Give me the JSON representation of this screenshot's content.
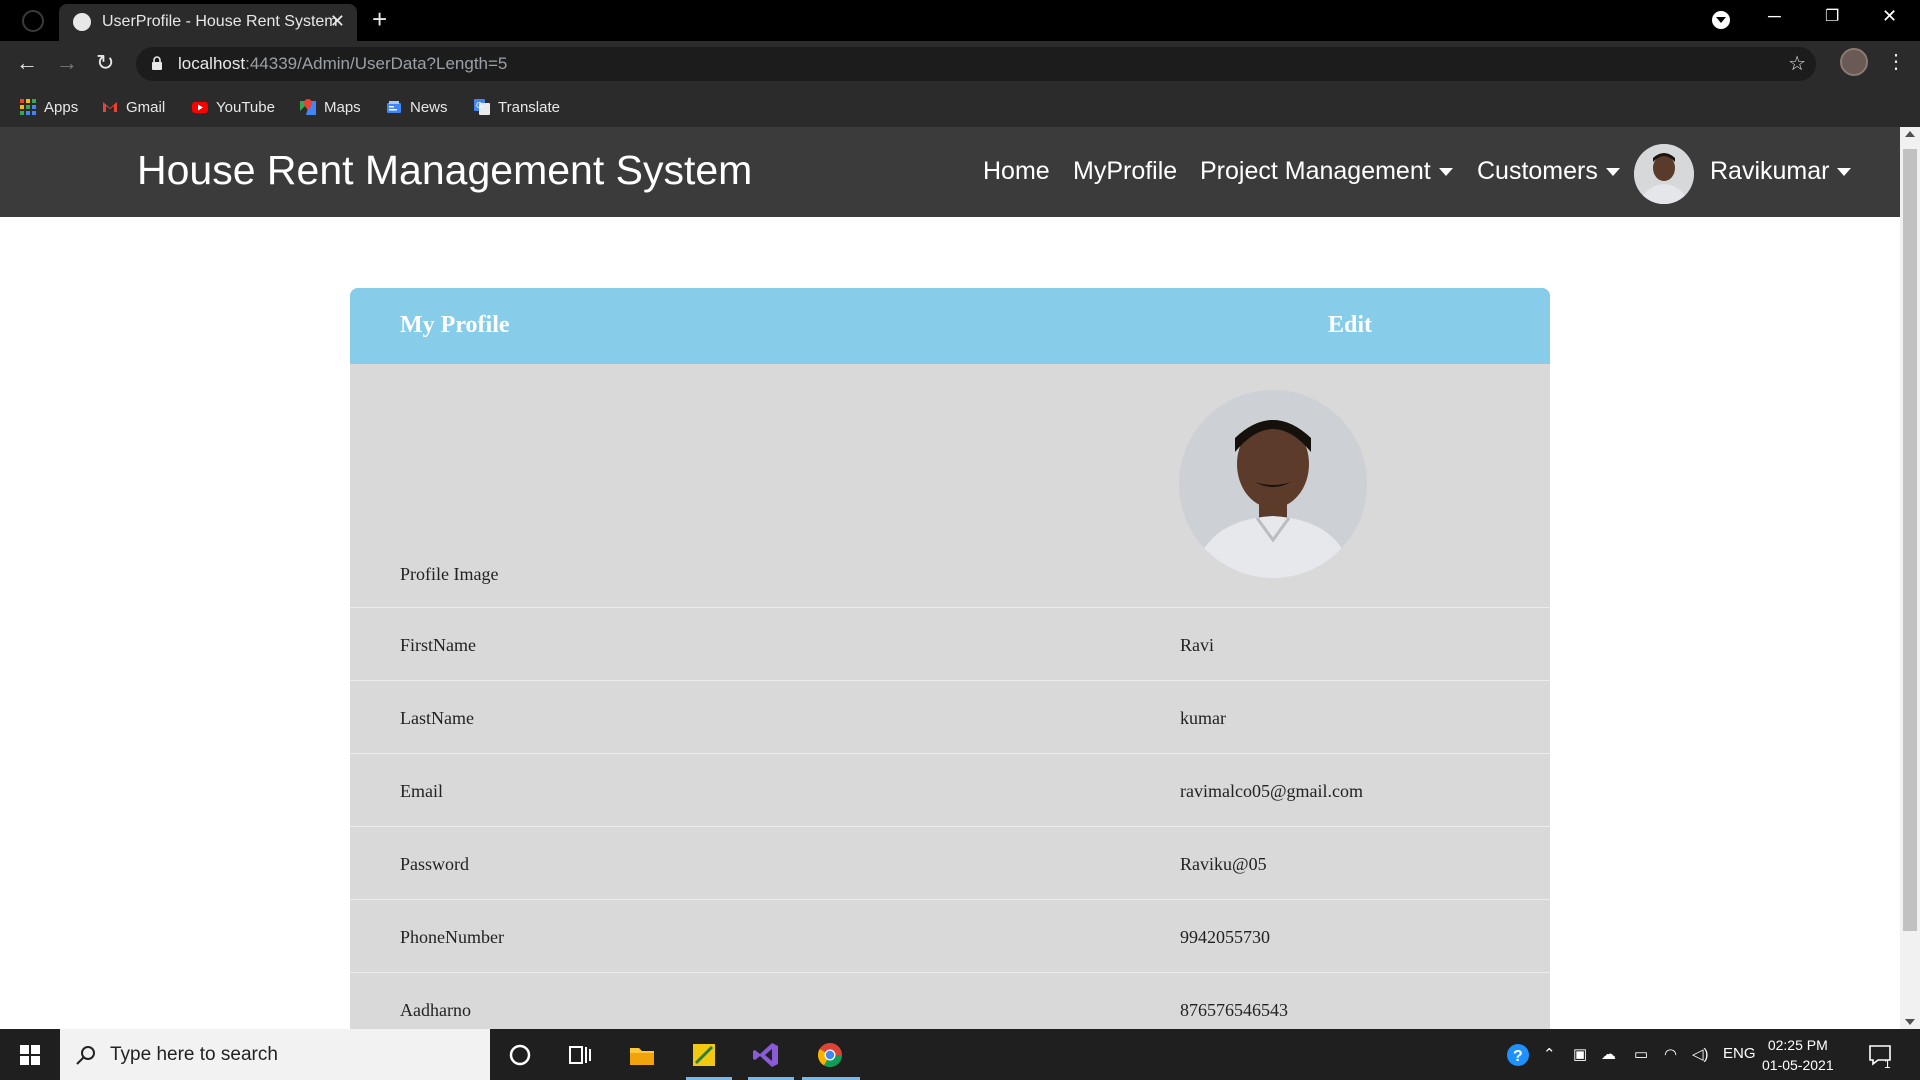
{
  "browser": {
    "tab_title": "UserProfile - House Rent System",
    "url_host": "localhost",
    "url_rest": ":44339/Admin/UserData?Length=5",
    "bookmarks": [
      "Apps",
      "Gmail",
      "YouTube",
      "Maps",
      "News",
      "Translate"
    ]
  },
  "site": {
    "brand": "House Rent Management System",
    "nav": {
      "home": "Home",
      "myprofile": "MyProfile",
      "project_management": "Project Management",
      "customers": "Customers",
      "user": "Ravikumar"
    }
  },
  "profile": {
    "header_title": "My Profile",
    "edit_label": "Edit",
    "image_label": "Profile Image",
    "fields": [
      {
        "label": "FirstName",
        "value": "Ravi"
      },
      {
        "label": "LastName",
        "value": "kumar"
      },
      {
        "label": "Email",
        "value": "ravimalco05@gmail.com"
      },
      {
        "label": "Password",
        "value": "Raviku@05"
      },
      {
        "label": "PhoneNumber",
        "value": "9942055730"
      },
      {
        "label": "Aadharno",
        "value": "876576546543"
      }
    ]
  },
  "taskbar": {
    "search_placeholder": "Type here to search",
    "lang": "ENG",
    "time": "02:25 PM",
    "date": "01-05-2021",
    "notification_count": "1"
  },
  "colors": {
    "card_header": "#87cdea",
    "card_body": "#d9d9d9",
    "navbar": "#3b3b3b"
  }
}
